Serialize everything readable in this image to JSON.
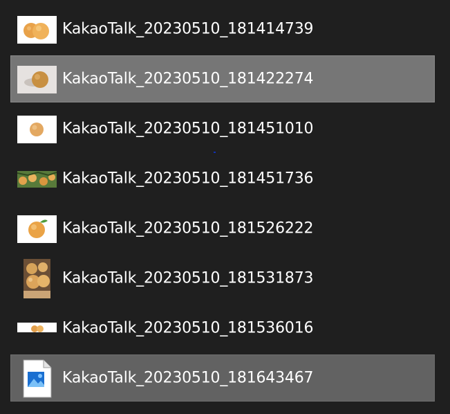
{
  "files": [
    {
      "name": "KakaoTalk_20230510_181414739",
      "icon": "pear-photo-thumbnail-icon"
    },
    {
      "name": "KakaoTalk_20230510_181422274",
      "icon": "pear-photo-thumbnail-icon"
    },
    {
      "name": "KakaoTalk_20230510_181451010",
      "icon": "pear-photo-thumbnail-icon"
    },
    {
      "name": "KakaoTalk_20230510_181451736",
      "icon": "pear-tree-photo-thumbnail-icon"
    },
    {
      "name": "KakaoTalk_20230510_181526222",
      "icon": "pear-photo-thumbnail-icon"
    },
    {
      "name": "KakaoTalk_20230510_181531873",
      "icon": "pear-box-photo-thumbnail-icon"
    },
    {
      "name": "KakaoTalk_20230510_181536016",
      "icon": "pear-photo-thumbnail-icon"
    },
    {
      "name": "KakaoTalk_20230510_181643467",
      "icon": "image-file-icon"
    }
  ],
  "colors": {
    "background": "#1f1f1f",
    "selected": "#767676",
    "hovered": "#626262",
    "text": "#ffffff"
  }
}
